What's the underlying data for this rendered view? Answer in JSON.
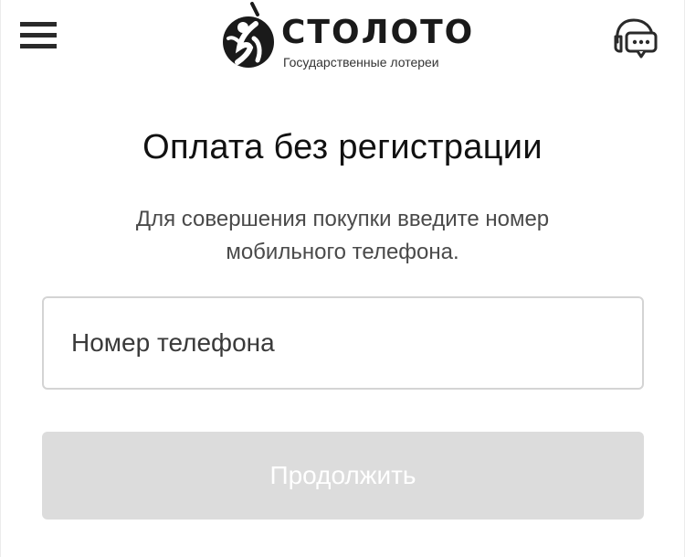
{
  "header": {
    "menu_icon": "hamburger-menu-icon",
    "logo": {
      "wordmark": "СТОЛОТО",
      "tagline": "Государственные лотереи"
    },
    "chat_icon": "support-chat-icon"
  },
  "main": {
    "title": "Оплата без регистрации",
    "description_line1": "Для совершения покупки введите номер",
    "description_line2": "мобильного телефона.",
    "phone_input": {
      "placeholder": "Номер телефона",
      "value": ""
    },
    "continue_button": {
      "label": "Продолжить",
      "disabled": true
    }
  },
  "colors": {
    "text": "#111111",
    "button_disabled_bg": "#dcdcdc",
    "button_disabled_text": "#ffffff",
    "input_border": "#d4d4d4"
  }
}
